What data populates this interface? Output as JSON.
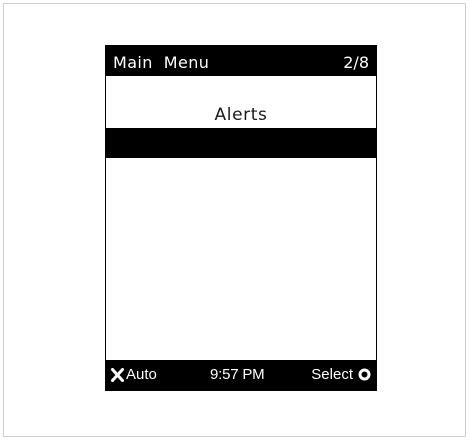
{
  "header": {
    "title": "Main  Menu",
    "page_indicator": "2/8"
  },
  "menu": {
    "current_item": "Alerts"
  },
  "footer": {
    "left_label": "Auto",
    "left_icon": "x-icon",
    "time": "9:57 PM",
    "right_label": "Select",
    "right_icon": "select-circle-icon"
  }
}
